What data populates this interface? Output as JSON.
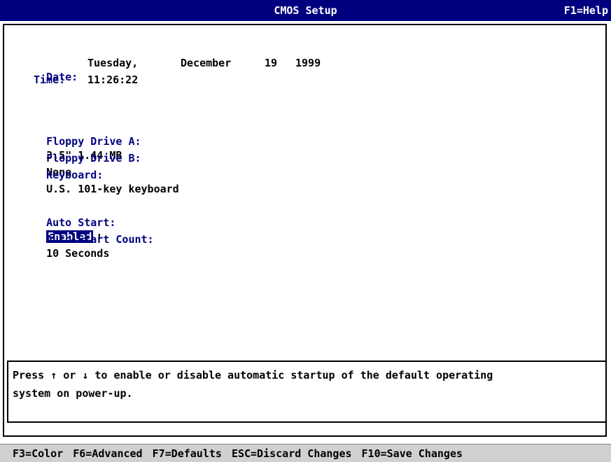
{
  "header": {
    "title": "CMOS Setup",
    "help": "F1=Help"
  },
  "date": {
    "label": "Date:",
    "weekday": "Tuesday,",
    "month": "December",
    "day": "19",
    "year": "1999"
  },
  "time": {
    "label": "Time:",
    "value": "11:26:22"
  },
  "drives": {
    "floppy_a_label": "Floppy Drive A:",
    "floppy_a_value": "3.5\" 1.44 MB",
    "floppy_b_label": "Floppy Drive B:",
    "floppy_b_value": "None",
    "keyboard_label": "Keyboard:",
    "keyboard_value": "U.S. 101-key keyboard"
  },
  "autostart": {
    "label": "Auto Start:",
    "value": "Enabled",
    "count_label": "Auto Start Count:",
    "count_value": "10 Seconds"
  },
  "help_text": {
    "line1": "Press ↑ or ↓ to enable or disable automatic startup of the default operating",
    "line2": "system on power-up."
  },
  "footer": {
    "f3": "F3=Color",
    "f6": "F6=Advanced",
    "f7": "F7=Defaults",
    "esc": "ESC=Discard Changes",
    "f10": "F10=Save Changes"
  },
  "colors": {
    "title_bg": "#00007f",
    "label": "#00007f",
    "footer_bg": "#d0d0d0"
  },
  "icons": {
    "dropdown": "down-arrow-icon"
  }
}
